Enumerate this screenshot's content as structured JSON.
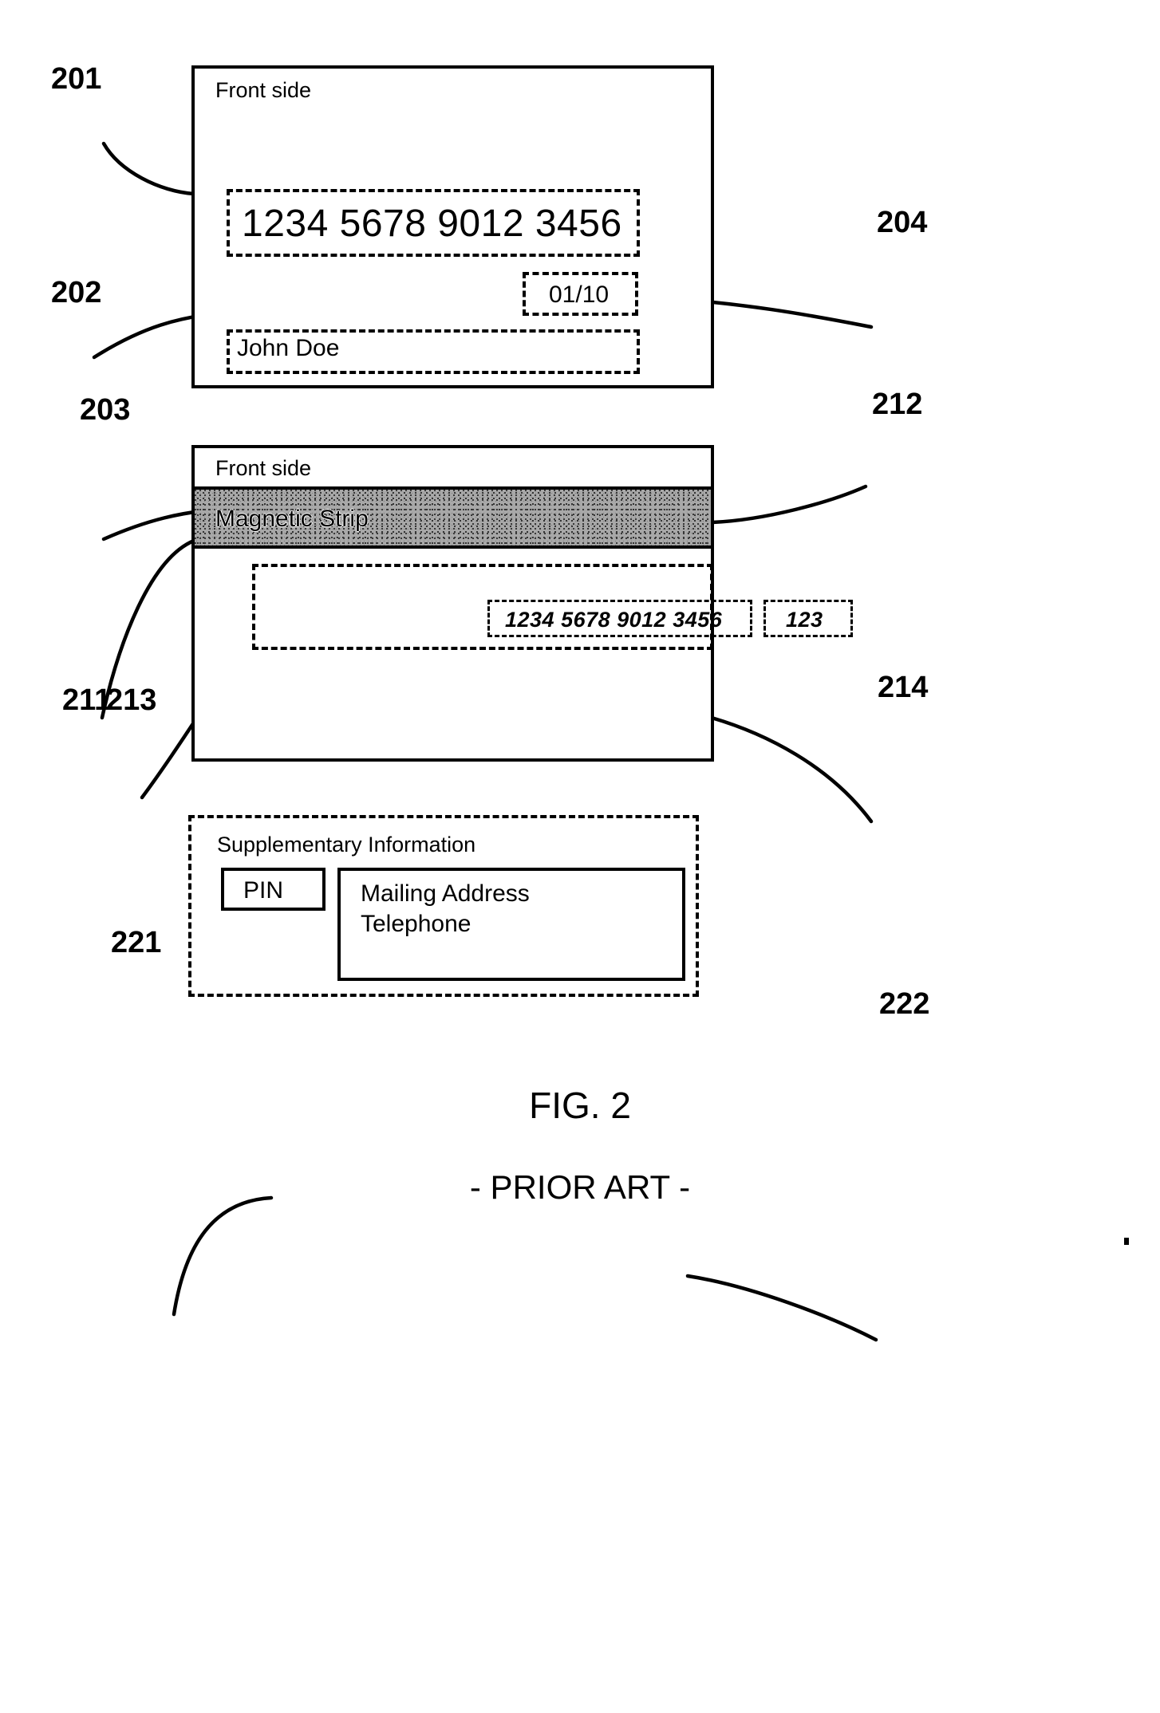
{
  "figure": {
    "caption": "FIG. 2",
    "subcaption": "- PRIOR ART -"
  },
  "card_front": {
    "ref": "201",
    "side_label": "Front side",
    "card_number": {
      "ref": "202",
      "value": "1234 5678 9012 3456"
    },
    "expiry": {
      "ref": "204",
      "value": "01/10"
    },
    "cardholder": {
      "ref": "203",
      "value": "John Doe"
    }
  },
  "card_back": {
    "ref": "211",
    "side_label": "Front side",
    "magnetic_strip": {
      "ref": "212",
      "label": "Magnetic Strip"
    },
    "signature_panel": {
      "ref": "213",
      "card_number": "1234 5678 9012 3456"
    },
    "security_code": {
      "ref": "214",
      "value": "123"
    }
  },
  "supplementary": {
    "title": "Supplementary Information",
    "pin": {
      "ref": "221",
      "label": "PIN"
    },
    "contact": {
      "ref": "222",
      "lines": "Mailing Address\nTelephone"
    }
  }
}
